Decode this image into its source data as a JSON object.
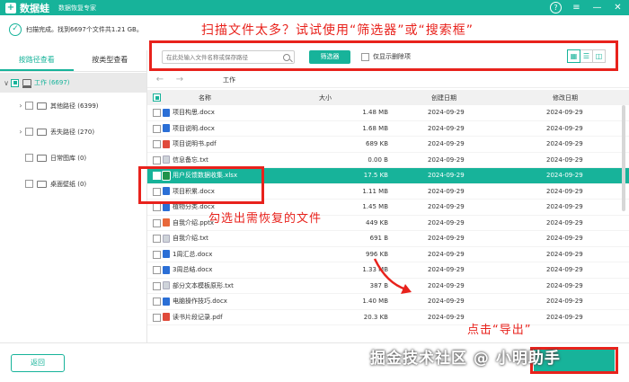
{
  "app": {
    "name": "数据蛙",
    "subtitle": "数据恢复专家",
    "logo_glyph": "+",
    "accent_color": "#17b39a",
    "window_buttons": [
      {
        "name": "help-icon",
        "glyph": "?"
      },
      {
        "name": "menu-icon",
        "glyph": "≡"
      },
      {
        "name": "minimize-icon",
        "glyph": "—"
      },
      {
        "name": "close-icon",
        "glyph": "✕"
      }
    ]
  },
  "status": {
    "text": "扫描完成。找到6697个文件共1.21 GB。"
  },
  "annotations": {
    "top": "扫描文件太多？试试使用“筛选器”或“搜索框”",
    "middle": "勾选出需恢复的文件",
    "bottom": "点击“导出”",
    "annotation_color": "#e8221c"
  },
  "watermark": "掘金技术社区 @ 小明助手",
  "sidebar": {
    "tabs": [
      {
        "label": "按路径查看",
        "active": true
      },
      {
        "label": "按类型查看",
        "active": false
      }
    ],
    "tree": [
      {
        "label": "工作 (6697)",
        "root": true,
        "check": "partial"
      },
      {
        "label": "其他路径 (6399)",
        "caret": "›",
        "check": "none"
      },
      {
        "label": "丢失路径 (270)",
        "caret": "›",
        "check": "none"
      },
      {
        "label": "日常图库 (0)",
        "caret": "",
        "check": "none"
      },
      {
        "label": "桌面壁纸 (0)",
        "caret": "",
        "check": "none"
      }
    ],
    "back_label": "返回"
  },
  "toolbar": {
    "search_placeholder": "在此处输入文件名称或保存路径",
    "filter_label": "筛选器",
    "deleted_only_label": "仅显示删除项",
    "view_modes": [
      {
        "name": "grid-view-icon",
        "glyph": "▦",
        "active": true
      },
      {
        "name": "list-view-icon",
        "glyph": "☰",
        "active": false
      },
      {
        "name": "detail-view-icon",
        "glyph": "◫",
        "active": false
      }
    ]
  },
  "nav": {
    "back_glyph": "←",
    "forward_glyph": "→",
    "path": "工作"
  },
  "table": {
    "headers": {
      "name": "名称",
      "size": "大小",
      "created": "创建日期",
      "modified": "修改日期"
    },
    "rows": [
      {
        "name": "项目构思.docx",
        "type": "docx",
        "size": "1.48 MB",
        "created": "2024-09-29",
        "modified": "2024-09-29",
        "selected": false
      },
      {
        "name": "项目说明.docx",
        "type": "docx",
        "size": "1.68 MB",
        "created": "2024-09-29",
        "modified": "2024-09-29",
        "selected": false
      },
      {
        "name": "项目说明书.pdf",
        "type": "pdf",
        "size": "689 KB",
        "created": "2024-09-29",
        "modified": "2024-09-29",
        "selected": false
      },
      {
        "name": "信息备忘.txt",
        "type": "txt",
        "size": "0.00 B",
        "created": "2024-09-29",
        "modified": "2024-09-29",
        "selected": false
      },
      {
        "name": "用户反馈数据收集.xlsx",
        "type": "xlsx",
        "size": "17.5 KB",
        "created": "2024-09-29",
        "modified": "2024-09-29",
        "selected": true
      },
      {
        "name": "项目积累.docx",
        "type": "docx",
        "size": "1.11 MB",
        "created": "2024-09-29",
        "modified": "2024-09-29",
        "selected": false
      },
      {
        "name": "植物分类.docx",
        "type": "docx",
        "size": "1.45 MB",
        "created": "2024-09-29",
        "modified": "2024-09-29",
        "selected": false
      },
      {
        "name": "自我介绍.pptx",
        "type": "pptx",
        "size": "449 KB",
        "created": "2024-09-29",
        "modified": "2024-09-29",
        "selected": false
      },
      {
        "name": "自我介绍.txt",
        "type": "txt",
        "size": "691 B",
        "created": "2024-09-29",
        "modified": "2024-09-29",
        "selected": false
      },
      {
        "name": "1周汇总.docx",
        "type": "docx",
        "size": "996 KB",
        "created": "2024-09-29",
        "modified": "2024-09-29",
        "selected": false
      },
      {
        "name": "3周总结.docx",
        "type": "docx",
        "size": "1.33 MB",
        "created": "2024-09-29",
        "modified": "2024-09-29",
        "selected": false
      },
      {
        "name": "部分文本模板原形.txt",
        "type": "txt",
        "size": "387 B",
        "created": "2024-09-29",
        "modified": "2024-09-29",
        "selected": false
      },
      {
        "name": "电脑操作技巧.docx",
        "type": "docx",
        "size": "1.40 MB",
        "created": "2024-09-29",
        "modified": "2024-09-29",
        "selected": false
      },
      {
        "name": "读书片段记录.pdf",
        "type": "pdf",
        "size": "20.3 KB",
        "created": "2024-09-29",
        "modified": "2024-09-29",
        "selected": false
      }
    ]
  }
}
